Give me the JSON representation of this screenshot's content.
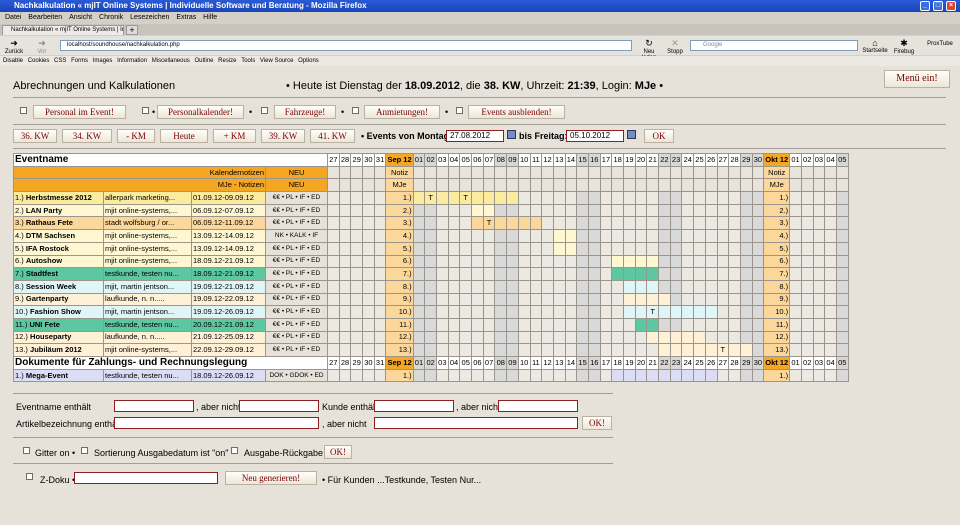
{
  "window": {
    "title": "Nachkalkulation « mjIT Online Systems | Individuelle Software und Beratung - Mozilla Firefox",
    "controls": [
      "_",
      "□",
      "×"
    ]
  },
  "menu": [
    "Datei",
    "Bearbeiten",
    "Ansicht",
    "Chronik",
    "Lesezeichen",
    "Extras",
    "Hilfe"
  ],
  "tab": {
    "label": "Nachkalkulation « mjIT Online Systems | Indi...",
    "new": "+"
  },
  "nav": {
    "back": "Zurück",
    "forward": "Vor",
    "reload": "Neu laden",
    "stop": "Stopp",
    "home": "Startseite",
    "firebug": "Firebug",
    "proxy": "ProxTube",
    "url": "localhost/soundhouse/nachkalkulation.php",
    "search_placeholder": "Google"
  },
  "devbar": [
    "Disable",
    "Cookies",
    "CSS",
    "Forms",
    "Images",
    "Information",
    "Miscellaneous",
    "Outline",
    "Resize",
    "Tools",
    "View Source",
    "Options"
  ],
  "page": {
    "heading": "Abrechnungen und Kalkulationen",
    "status_prefix": "• Heute ist Dienstag der ",
    "date": "18.09.2012",
    "status_mid1": ", die ",
    "week": "38. KW",
    "status_mid2": ", Uhrzeit: ",
    "time": "21:39",
    "status_mid3": ", Login: ",
    "login": "MJe",
    "status_suffix": " •",
    "menu_button": "Menü ein!"
  },
  "filters": [
    "Personal im Event!",
    "Personalkalender!",
    "Fahrzeuge!",
    "Anmietungen!",
    "Events ausblenden!"
  ],
  "weeknav": {
    "buttons": [
      "36. KW",
      "34. KW",
      "- KM",
      "Heute",
      "+ KM",
      "39. KW",
      "41. KW"
    ],
    "from_label": "• Events von Montag:",
    "from": "27.08.2012",
    "to_label": "bis Freitag:",
    "to": "05.10.2012",
    "ok": "OK"
  },
  "days": [
    "27",
    "28",
    "29",
    "30",
    "31",
    "Sep 12",
    "01",
    "02",
    "03",
    "04",
    "05",
    "06",
    "07",
    "08",
    "09",
    "10",
    "11",
    "12",
    "13",
    "14",
    "15",
    "16",
    "17",
    "18",
    "19",
    "20",
    "21",
    "22",
    "23",
    "24",
    "25",
    "26",
    "27",
    "28",
    "29",
    "30",
    "Okt 12",
    "01",
    "02",
    "03",
    "04",
    "05"
  ],
  "header": {
    "eventname": "Eventname",
    "kal_notes": "Kalendernotizen",
    "neu": "NEU",
    "mje_notes": "MJe - Notizen",
    "notiz": "Notiz",
    "mje": "MJe"
  },
  "events": [
    {
      "no": "1.)",
      "name": "Herbstmesse 2012",
      "client": "allerpark marketing...",
      "dates": "01.09.12-09.09.12",
      "flags": "€€ • PL • IF • ED"
    },
    {
      "no": "2.)",
      "name": "LAN Party",
      "client": "mjit online-systems,...",
      "dates": "06.09.12-07.09.12",
      "flags": "€€ • PL • IF • ED"
    },
    {
      "no": "3.)",
      "name": "Rathaus Fete",
      "client": "stadt wolfsburg / or...",
      "dates": "06.09.12-11.09.12",
      "flags": "€€ • PL • IF • ED"
    },
    {
      "no": "4.)",
      "name": "DTM Sachsen",
      "client": "mjit online-systems,...",
      "dates": "13.09.12-14.09.12",
      "flags": "NK • KALK • IF"
    },
    {
      "no": "5.)",
      "name": "IFA Rostock",
      "client": "mjit online-systems,...",
      "dates": "13.09.12-14.09.12",
      "flags": "€€ • PL • IF • ED"
    },
    {
      "no": "6.)",
      "name": "Autoshow",
      "client": "mjit online-systems,...",
      "dates": "18.09.12-21.09.12",
      "flags": "€€ • PL • IF • ED"
    },
    {
      "no": "7.)",
      "name": "Stadtfest",
      "client": "testkunde, testen nu...",
      "dates": "18.09.12-21.09.12",
      "flags": "€€ • PL • IF • ED"
    },
    {
      "no": "8.)",
      "name": "Session Week",
      "client": "mjit, martin jentson...",
      "dates": "19.09.12-21.09.12",
      "flags": "€€ • PL • IF • ED"
    },
    {
      "no": "9.)",
      "name": "Gartenparty",
      "client": "laufkunde, n. n.....",
      "dates": "19.09.12-22.09.12",
      "flags": "€€ • PL • IF • ED"
    },
    {
      "no": "10.)",
      "name": "Fashion Show",
      "client": "mjit, martin jentson...",
      "dates": "19.09.12-26.09.12",
      "flags": "€€ • PL • IF • ED"
    },
    {
      "no": "11.)",
      "name": "UNI Fete",
      "client": "testkunde, testen nu...",
      "dates": "20.09.12-21.09.12",
      "flags": "€€ • PL • IF • ED"
    },
    {
      "no": "12.)",
      "name": "Houseparty",
      "client": "laufkunde, n. n.....",
      "dates": "21.09.12-25.09.12",
      "flags": "€€ • PL • IF • ED"
    },
    {
      "no": "13.)",
      "name": "Jubiläum 2012",
      "client": "mjit online-systems,...",
      "dates": "22.09.12-29.09.12",
      "flags": "€€ • PL • IF • ED"
    }
  ],
  "docs_heading": "Dokumente für Zahlungs- und Rechnungslegung",
  "docs": [
    {
      "no": "1.)",
      "name": "Mega-Event",
      "client": "testkunde, testen nu...",
      "dates": "18.09.12-26.09.12",
      "flags": "DOK • GDOK • ED"
    }
  ],
  "cell_marks": [
    {
      "row": 0,
      "col": "02",
      "text": "T"
    },
    {
      "row": 0,
      "col": "05",
      "text": "T"
    },
    {
      "row": 2,
      "col": "07",
      "text": "T"
    },
    {
      "row": 9,
      "col": "21",
      "text": "T"
    },
    {
      "row": 12,
      "col": "27",
      "text": "T"
    }
  ],
  "search": {
    "eventname_label": "Eventname enthält",
    "but_not": ", aber nicht",
    "kunde_label": "Kunde enthält",
    "artikel_label": "Artikelbezeichnung enthält",
    "ok": "OK!"
  },
  "options": {
    "gitter": "Gitter on •",
    "sort": "Sortierung Ausgabedatum ist \"on\" •",
    "rueckgabe": "Ausgabe-Rückgabe •",
    "ok": "OK!"
  },
  "zdoku": {
    "label": "Z-Doku •",
    "button": "Neu generieren!",
    "info": "• Für Kunden ...Testkunde, Testen Nur..."
  },
  "colors": {
    "orange": "#f5a623",
    "yellow": "#fbeb9e",
    "green": "#5cc7a0",
    "lightblue": "#dff5f7",
    "blue": "#cde3f7",
    "peach": "#fff1d6",
    "lavender": "#dcdcf5"
  }
}
